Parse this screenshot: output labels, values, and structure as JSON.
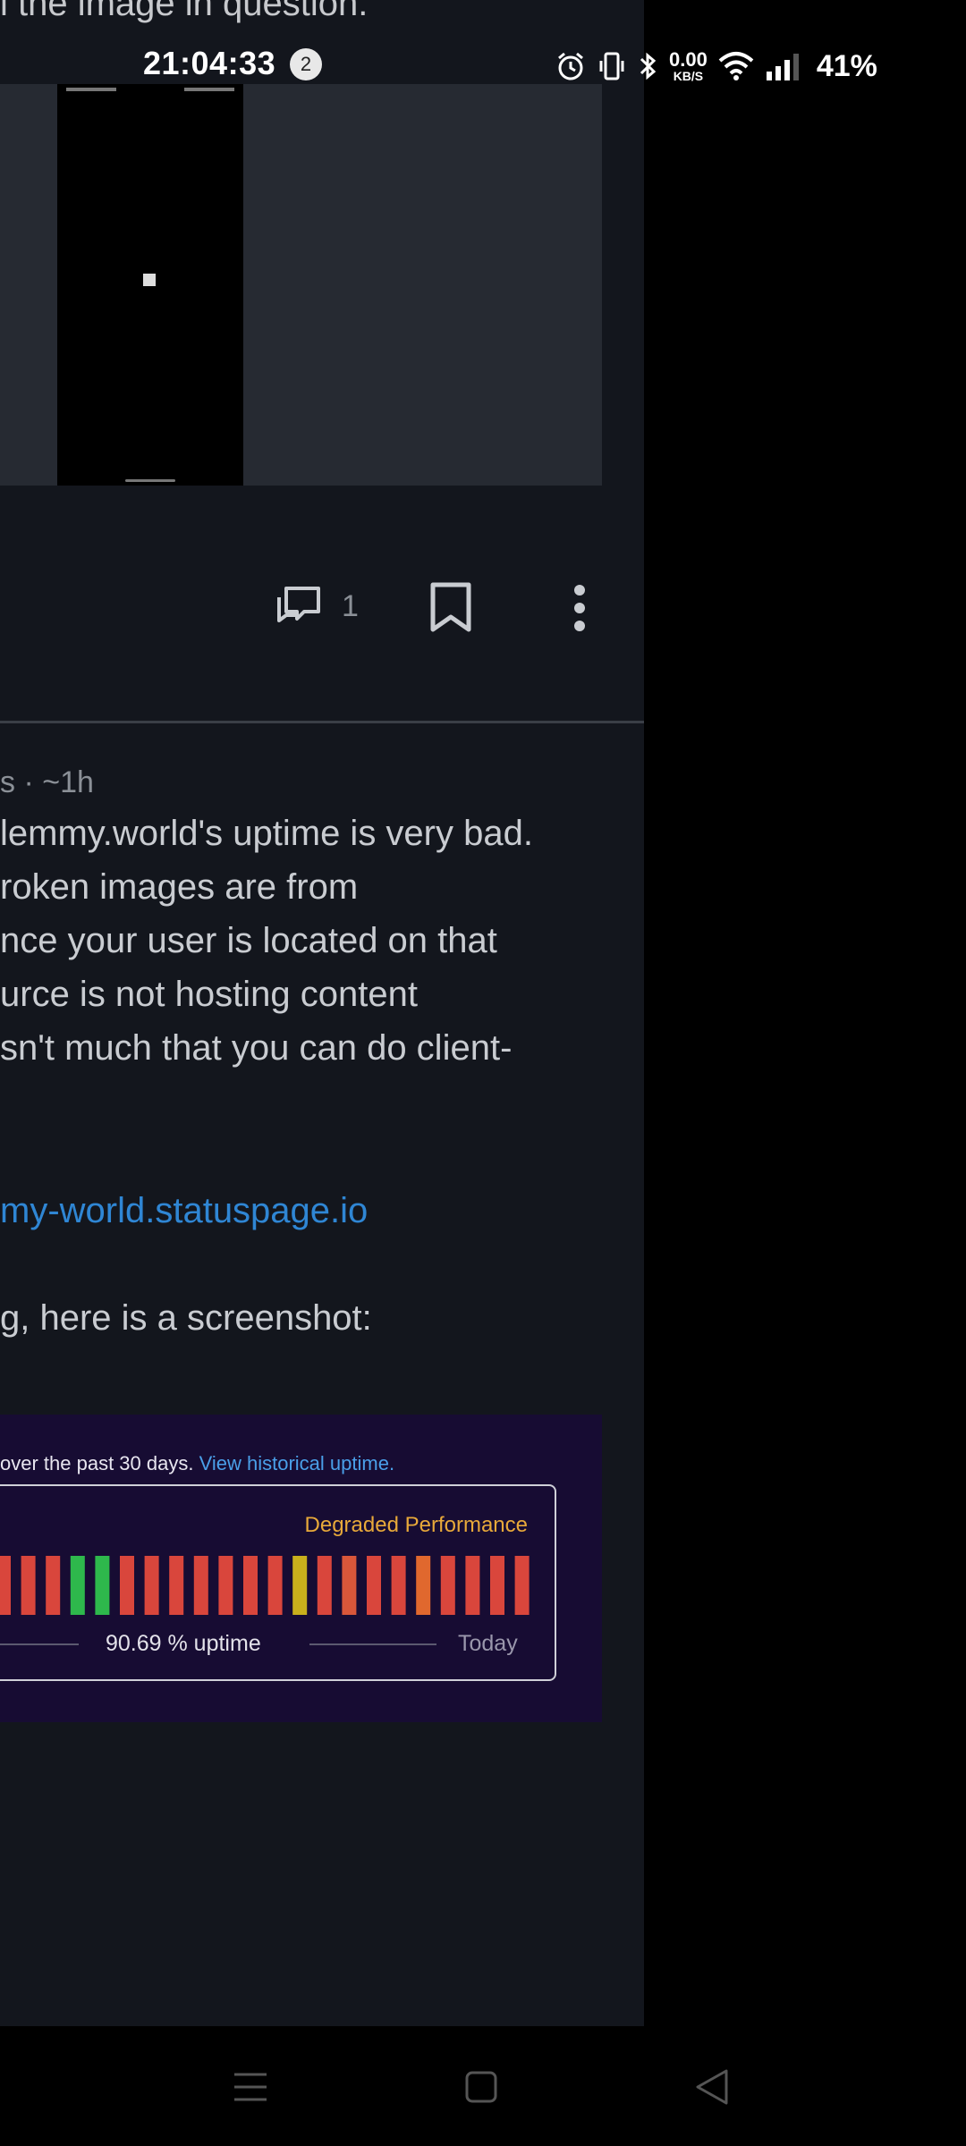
{
  "top_text": "l the image in question.",
  "status_bar": {
    "time": "21:04:33",
    "notification_count": "2",
    "speed_value": "0.00",
    "speed_unit": "KB/S",
    "battery": "41%"
  },
  "post_actions": {
    "comment_count": "1"
  },
  "comment": {
    "meta": "s · ~1h",
    "lines": [
      "lemmy.world's uptime is very bad.",
      "roken images are from",
      "nce your user is located on that",
      "urce is not hosting content",
      "sn't much that you can do client-"
    ],
    "link": "my-world.statuspage.io",
    "line_after_link": "g, here is a screenshot:"
  },
  "status_screenshot": {
    "caption_text": "over the past 30 days.",
    "caption_link": "View historical uptime.",
    "state": "Degraded Performance",
    "uptime": "90.69 % uptime",
    "today": "Today",
    "bar_colors": [
      "#d9463c",
      "#d9463c",
      "#d9463c",
      "#2eb84c",
      "#2eb84c",
      "#d9463c",
      "#d9463c",
      "#d9463c",
      "#d9463c",
      "#d9463c",
      "#d9463c",
      "#d9463c",
      "#c9b01c",
      "#d9463c",
      "#d9573a",
      "#d9463c",
      "#d9463c",
      "#e0682e",
      "#d9463c",
      "#d9463c",
      "#d9463c",
      "#d9463c"
    ]
  },
  "colors": {
    "background": "#13161d",
    "link": "#2f86d4",
    "degraded": "#e8a93a"
  }
}
